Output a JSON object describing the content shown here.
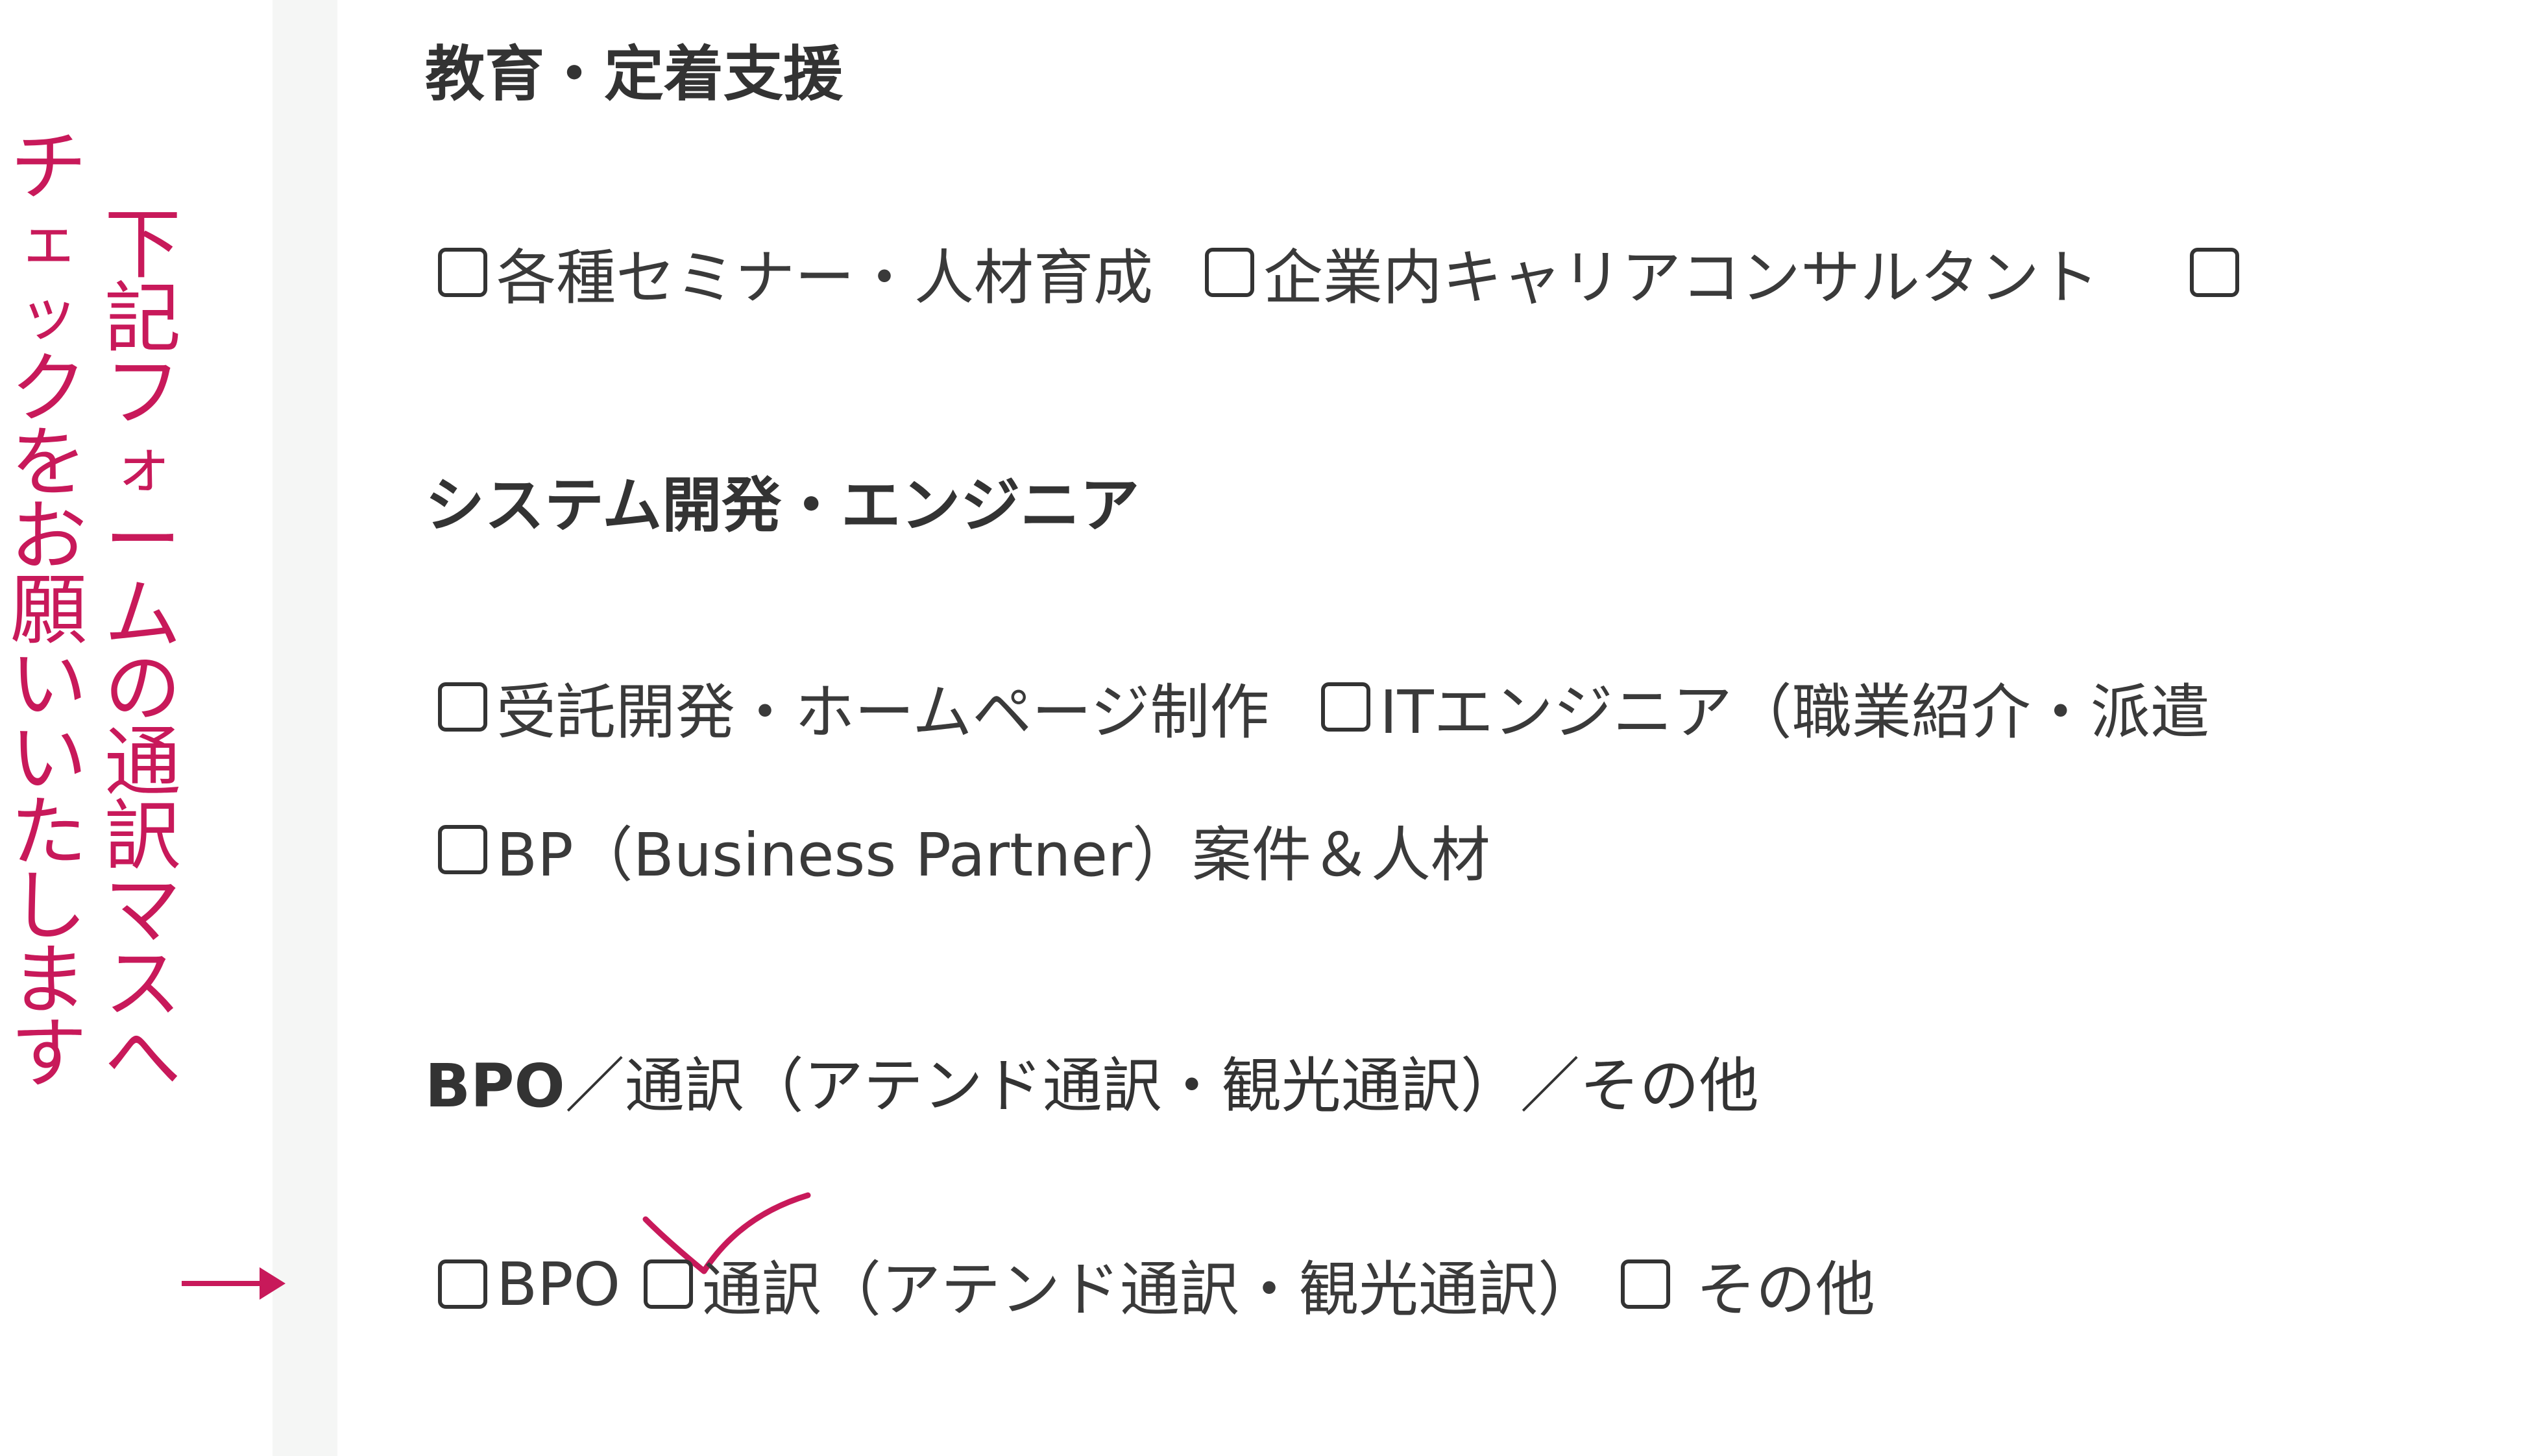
{
  "annotation": {
    "left_column": [
      "チ",
      "ェ",
      "ッ",
      "ク",
      "を",
      "お",
      "願",
      "い",
      "い",
      "た",
      "し",
      "ま",
      "す"
    ],
    "right_column": [
      "下",
      "記",
      "フ",
      "ォ",
      "ー",
      "ム",
      "の",
      "通",
      "訳",
      "マ",
      "ス",
      "へ"
    ],
    "arrow": "→",
    "color": "#c8195a"
  },
  "sections": [
    {
      "title": "教育・定着支援",
      "rows": [
        [
          "各種セミナー・人材育成",
          "企業内キャリアコンサルタント",
          ""
        ]
      ]
    },
    {
      "title": "システム開発・エンジニア",
      "rows": [
        [
          "受託開発・ホームページ制作",
          "ITエンジニア（職業紹介・派遣"
        ],
        [
          "BP（Business Partner）案件＆人材"
        ]
      ]
    },
    {
      "title_bold": "BPO",
      "title_rest": "／通訳（アテンド通訳・観光通訳）／その他",
      "rows": [
        [
          "BPO",
          "通訳（アテンド通訳・観光通訳）",
          "その他"
        ]
      ]
    }
  ]
}
